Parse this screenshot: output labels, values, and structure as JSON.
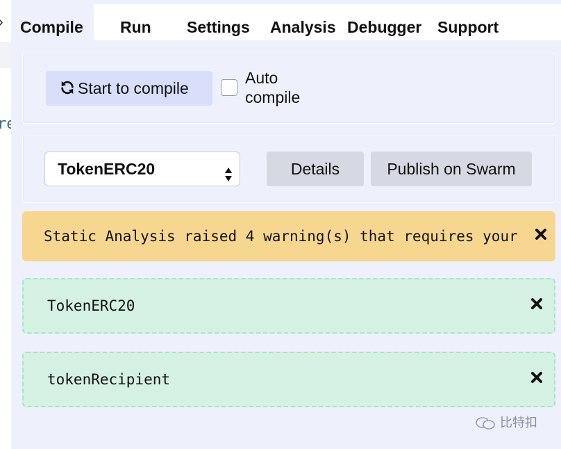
{
  "editor_fragment": {
    "arrow": "›",
    "code": "re"
  },
  "tabs": [
    {
      "label": "Compile",
      "active": true
    },
    {
      "label": "Run",
      "active": false
    },
    {
      "label": "Settings",
      "active": false
    },
    {
      "label": "Analysis",
      "active": false
    },
    {
      "label": "Debugger",
      "active": false
    },
    {
      "label": "Support",
      "active": false
    }
  ],
  "compile": {
    "button_label": "Start to compile",
    "button_icon": "refresh-icon",
    "auto_compile_label": "Auto compile",
    "auto_compile_checked": false
  },
  "contract_select": {
    "selected": "TokenERC20",
    "details_label": "Details",
    "publish_label": "Publish on Swarm"
  },
  "warning": {
    "text": "Static Analysis raised 4 warning(s) that requires your",
    "color": "#f7d790"
  },
  "results": [
    {
      "name": "TokenERC20"
    },
    {
      "name": "tokenRecipient"
    }
  ],
  "success_color": "#d4f1e3",
  "watermark": {
    "text": "比特扣"
  }
}
